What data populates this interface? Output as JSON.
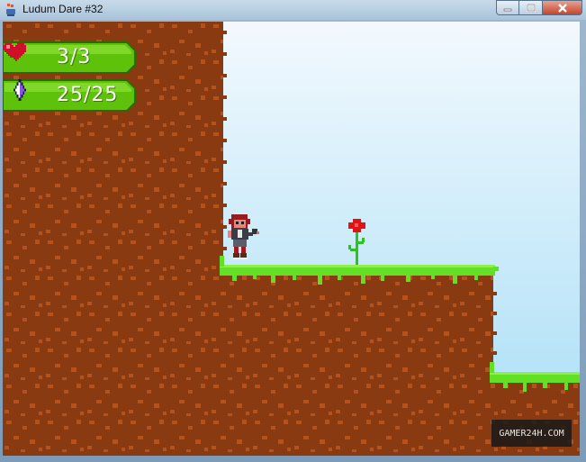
{
  "window": {
    "title": "Ludum Dare #32",
    "controls": [
      "minimize-icon",
      "maximize-icon",
      "close-icon"
    ]
  },
  "hud": {
    "health": {
      "icon": "heart-icon",
      "text": "3/3",
      "current": 3,
      "max": 3
    },
    "mana": {
      "icon": "crystal-icon",
      "text": "25/25",
      "current": 25,
      "max": 25
    }
  },
  "scene": {
    "elements": [
      "player-character",
      "red-flower",
      "dirt-cliff",
      "grass-platform",
      "lower-grass-ledge"
    ]
  },
  "watermark": {
    "text": "GAMER24H.COM"
  },
  "colors": {
    "dirt": "#893a10",
    "dirt_speck": "#b4521e",
    "grass": "#62e025",
    "grass_light": "#8cf24a",
    "sky_top": "#f2f8fd",
    "sky_bottom": "#a9dff6",
    "hud_green": "#5ec20a",
    "hud_border": "#2c6a00"
  }
}
